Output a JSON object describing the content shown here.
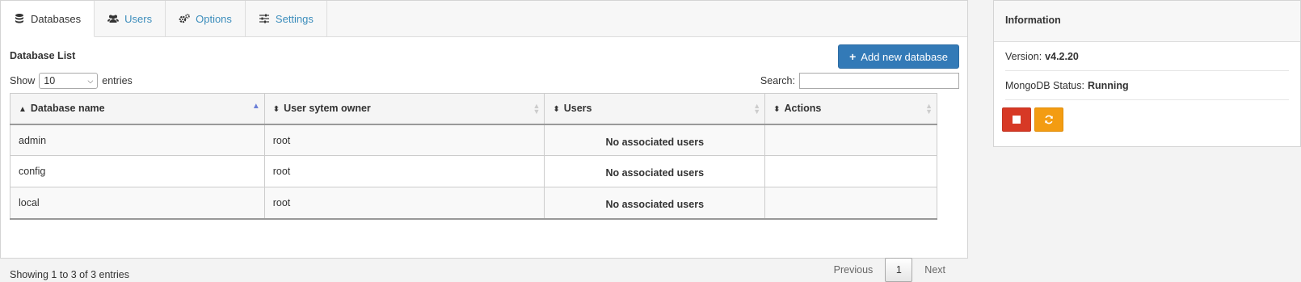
{
  "tabs": [
    {
      "label": "Databases",
      "icon": "database-icon",
      "active": true
    },
    {
      "label": "Users",
      "icon": "users-icon",
      "active": false
    },
    {
      "label": "Options",
      "icon": "gears-icon",
      "active": false
    },
    {
      "label": "Settings",
      "icon": "sliders-icon",
      "active": false
    }
  ],
  "db_list": {
    "title": "Database List",
    "add_button_label": "Add new database",
    "show_prefix": "Show",
    "show_value": "10",
    "show_suffix": "entries",
    "search_label": "Search:",
    "search_value": "",
    "columns": [
      "Database name",
      "User sytem owner",
      "Users",
      "Actions"
    ],
    "rows": [
      {
        "name": "admin",
        "owner": "root",
        "users": "No associated users",
        "actions": ""
      },
      {
        "name": "config",
        "owner": "root",
        "users": "No associated users",
        "actions": ""
      },
      {
        "name": "local",
        "owner": "root",
        "users": "No associated users",
        "actions": ""
      }
    ],
    "showing_text": "Showing 1 to 3 of 3 entries",
    "pager": {
      "previous": "Previous",
      "current": "1",
      "next": "Next"
    }
  },
  "info": {
    "title": "Information",
    "version_label": "Version:",
    "version_value": "v4.2.20",
    "status_label": "MongoDB Status:",
    "status_value": "Running"
  },
  "colors": {
    "primary": "#337ab7",
    "link": "#3c8dbc",
    "danger": "#d73925",
    "warning": "#f39c12"
  }
}
